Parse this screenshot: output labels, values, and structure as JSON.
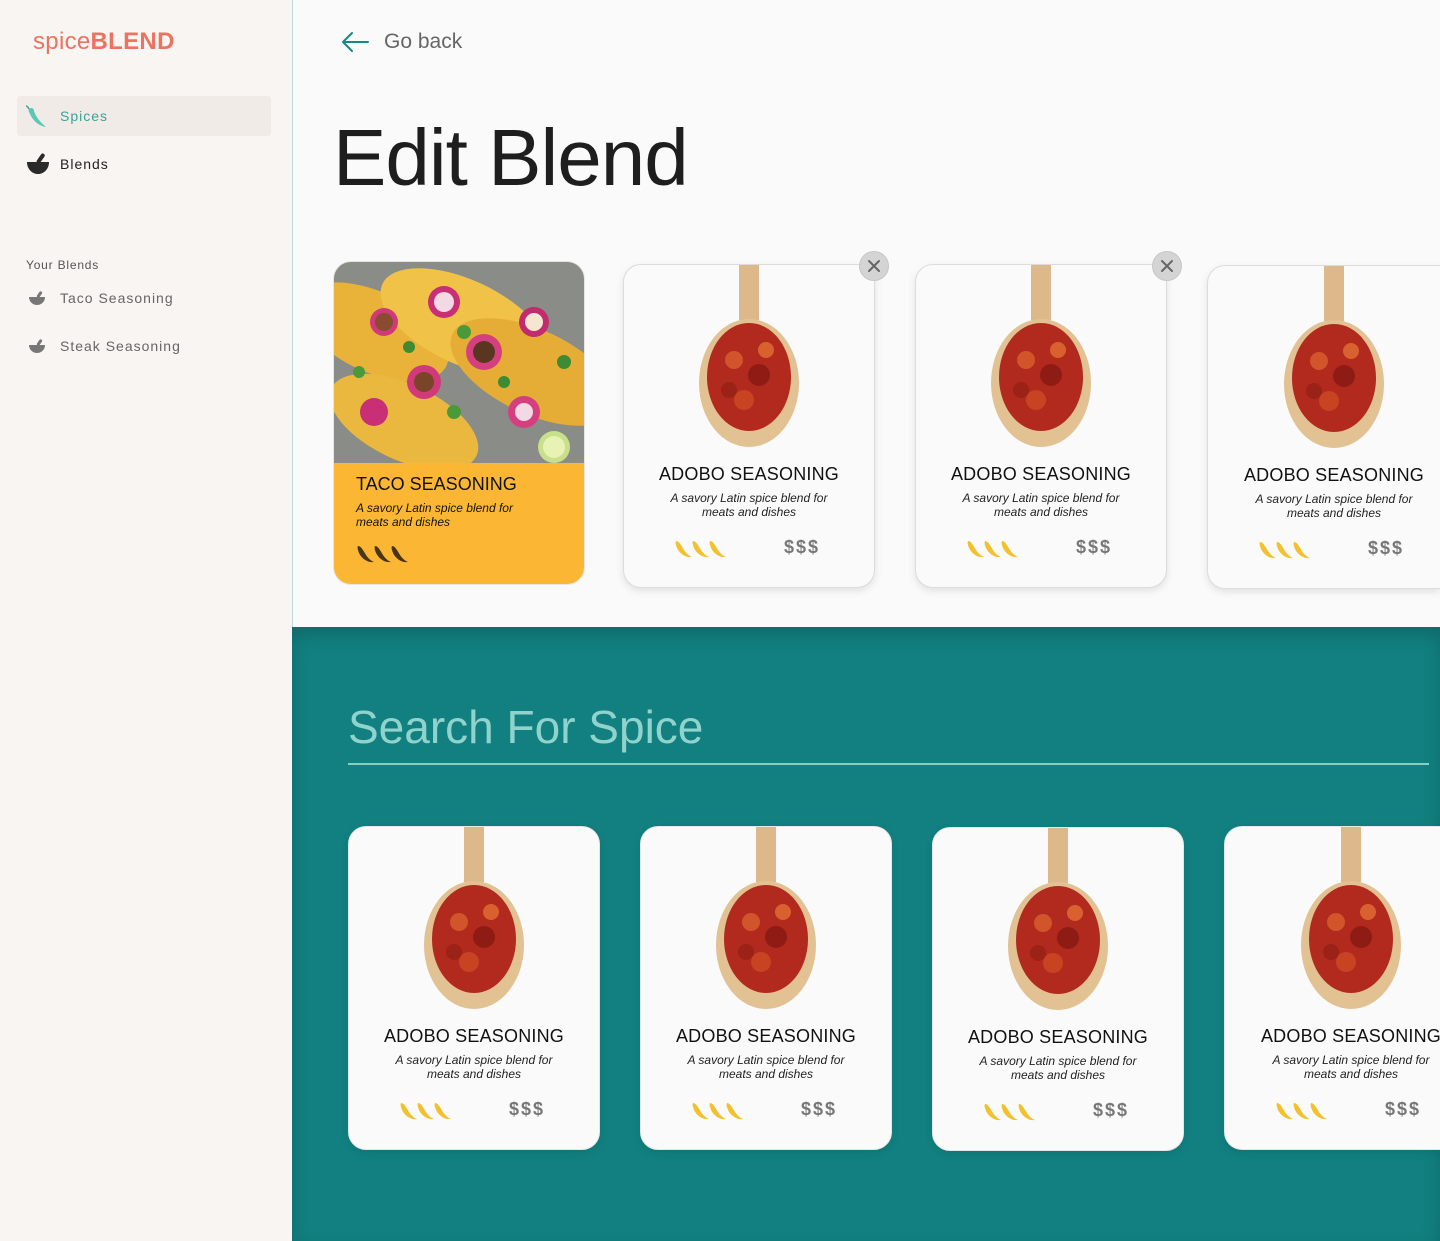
{
  "app": {
    "logo_light": "spice",
    "logo_bold": "BLEND"
  },
  "sidebar": {
    "nav": [
      {
        "label": "Spices",
        "icon": "pepper-icon",
        "active": true
      },
      {
        "label": "Blends",
        "icon": "mortar-bowl-icon",
        "active": false
      }
    ],
    "section_label": "Your Blends",
    "blends": [
      {
        "label": "Taco Seasoning",
        "icon": "mortar-bowl-icon"
      },
      {
        "label": "Steak Seasoning",
        "icon": "mortar-bowl-icon"
      }
    ]
  },
  "header": {
    "back_label": "Go back",
    "title": "Edit Blend"
  },
  "blend": {
    "featured": {
      "name": "TACO SEASONING",
      "description": "A savory Latin spice blend for meats and dishes",
      "heat_level": 3
    },
    "spices": [
      {
        "name": "ADOBO SEASONING",
        "description": "A savory Latin spice blend for meats and dishes",
        "heat_level": 3,
        "price": "$$$",
        "removable": true
      },
      {
        "name": "ADOBO SEASONING",
        "description": "A savory Latin spice blend for meats and dishes",
        "heat_level": 3,
        "price": "$$$",
        "removable": true
      },
      {
        "name": "ADOBO SEASONING",
        "description": "A savory Latin spice blend for meats and dishes",
        "heat_level": 3,
        "price": "$$$",
        "removable": false
      }
    ]
  },
  "search": {
    "placeholder": "Search For Spice",
    "results": [
      {
        "name": "ADOBO SEASONING",
        "description": "A savory Latin spice blend for meats and dishes",
        "heat_level": 3,
        "price": "$$$"
      },
      {
        "name": "ADOBO SEASONING",
        "description": "A savory Latin spice blend for meats and dishes",
        "heat_level": 3,
        "price": "$$$"
      },
      {
        "name": "ADOBO SEASONING",
        "description": "A savory Latin spice blend for meats and dishes",
        "heat_level": 3,
        "price": "$$$"
      },
      {
        "name": "ADOBO SEASONING",
        "description": "A savory Latin spice blend for meats and dishes",
        "heat_level": 3,
        "price": "$$$"
      }
    ]
  },
  "colors": {
    "brand": "#ec7362",
    "accent": "#3aa39a",
    "search_bg": "#128080",
    "featured_bg": "#fbb734",
    "pepper": "#f2c12e"
  }
}
